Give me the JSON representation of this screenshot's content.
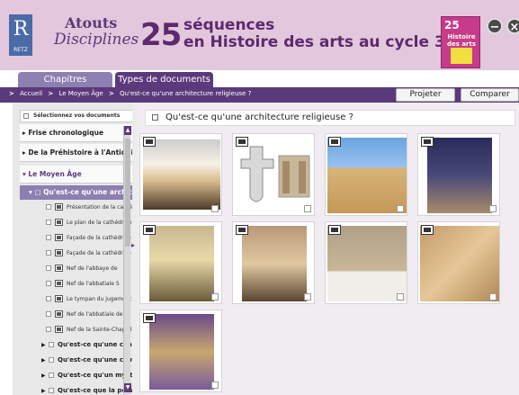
{
  "header": {
    "logo_letter": "R",
    "logo_brand": "RETZ",
    "collection_line1": "Atouts",
    "collection_line2": "Disciplines",
    "big_number": "25",
    "title_line1": "séquences",
    "title_line2": "en Histoire des arts au cycle 3",
    "book_cover_number": "25",
    "book_cover_text": "Histoire des arts",
    "minimize_symbol": "−",
    "close_symbol": "×"
  },
  "tabs": [
    {
      "label": "Chapitres",
      "active": false
    },
    {
      "label": "Types de documents",
      "active": true
    }
  ],
  "breadcrumb": [
    "Accueil",
    "Le Moyen Âge",
    "Qu'est-ce qu'une architecture religieuse ?"
  ],
  "breadcrumb_separator": ">",
  "toolbar": {
    "projeter": "Projeter",
    "comparer": "Comparer"
  },
  "sidebar": {
    "select_all": "Sélectionnez vos documents",
    "sections": [
      {
        "label": "Frise chronologique"
      },
      {
        "label": "De la Préhistoire à l'Antiquité"
      },
      {
        "label": "Le Moyen Âge"
      }
    ],
    "current_subsection": "Qu'est-ce qu'une architecture religieuse ?",
    "items": [
      {
        "label": "Présentation de la cathédrale",
        "icon": "document-icon"
      },
      {
        "label": "Le plan de la cathédrale",
        "icon": "plan-icon"
      },
      {
        "label": "Façade de la cathédrale",
        "icon": "image-icon"
      },
      {
        "label": "Façade de la cathédrale",
        "icon": "image-icon"
      },
      {
        "label": "Nef de l'abbaye de",
        "icon": "image-icon"
      },
      {
        "label": "Nef de l'abbatiale S",
        "icon": "image-icon"
      },
      {
        "label": "Le tympan du jugement",
        "icon": "plan-icon"
      },
      {
        "label": "Nef de l'abbatiale de",
        "icon": "image-icon"
      },
      {
        "label": "Nef de la Sainte-Chapelle",
        "icon": "image-icon"
      }
    ],
    "subsections": [
      {
        "label": "Qu'est-ce qu'une chanson"
      },
      {
        "label": "Qu'est-ce qu'une commande"
      },
      {
        "label": "Qu'est-ce qu'un mystère"
      },
      {
        "label": "Qu'est-ce que la perspective"
      }
    ]
  },
  "main": {
    "title": "Qu'est-ce qu'une architecture religieuse ?",
    "thumbnails": [
      {
        "name": "thumb-nave-cathedral",
        "badge": "document-icon"
      },
      {
        "name": "thumb-cathedral-plan",
        "badge": "plan-icon"
      },
      {
        "name": "thumb-notre-dame-facade",
        "badge": "image-icon"
      },
      {
        "name": "thumb-reims-facade",
        "badge": "image-icon"
      },
      {
        "name": "thumb-abbey-nave",
        "badge": "image-icon"
      },
      {
        "name": "thumb-abbatiale-nave",
        "badge": "image-icon"
      },
      {
        "name": "thumb-tympan",
        "badge": "plan-icon"
      },
      {
        "name": "thumb-vault",
        "badge": "image-icon"
      },
      {
        "name": "thumb-sainte-chapelle",
        "badge": "image-icon"
      }
    ]
  },
  "colors": {
    "header_bg": "#e3c7dc",
    "accent_purple": "#5b3a7c",
    "tab_inactive": "#8d7fb0",
    "content_bg": "#f1ecf2"
  }
}
